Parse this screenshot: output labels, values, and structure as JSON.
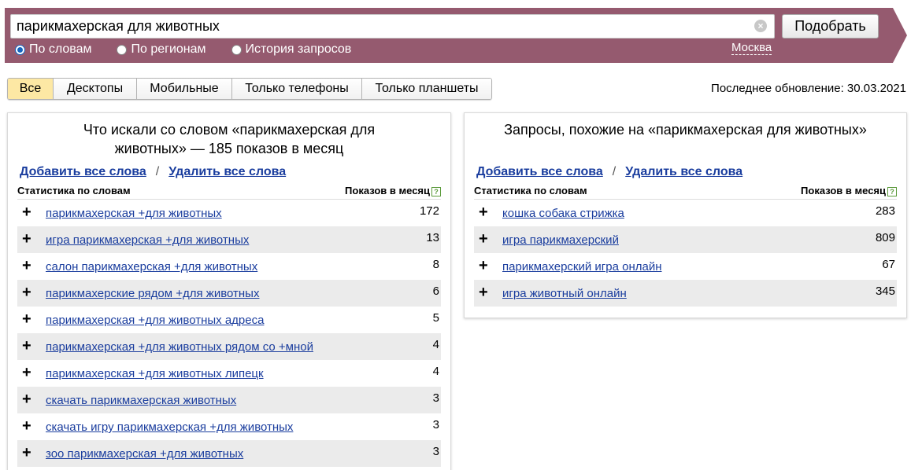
{
  "search": {
    "query": "парикмахерская для животных",
    "button_label": "Подобрать",
    "clear_icon": "x-circle-icon",
    "modes": [
      {
        "label": "По словам",
        "checked": true
      },
      {
        "label": "По регионам",
        "checked": false
      },
      {
        "label": "История запросов",
        "checked": false
      }
    ],
    "region": "Москва"
  },
  "colors": {
    "header_band": "#955a6f",
    "active_tab": "#fde8a4",
    "link": "#1a3d9e"
  },
  "tabs": [
    {
      "label": "Все",
      "active": true
    },
    {
      "label": "Десктопы",
      "active": false
    },
    {
      "label": "Мобильные",
      "active": false
    },
    {
      "label": "Только телефоны",
      "active": false
    },
    {
      "label": "Только планшеты",
      "active": false
    }
  ],
  "last_update": "Последнее обновление: 30.03.2021",
  "left_panel": {
    "title": "Что искали со словом «парикмахерская для животных» — 185 показов в месяц",
    "add_all": "Добавить все слова",
    "separator": "/",
    "remove_all": "Удалить все слова",
    "col_phrase": "Статистика по словам",
    "col_count": "Показов в месяц",
    "rows": [
      {
        "phrase": "парикмахерская +для животных",
        "count": "172"
      },
      {
        "phrase": "игра парикмахерская +для животных",
        "count": "13"
      },
      {
        "phrase": "салон парикмахерская +для животных",
        "count": "8"
      },
      {
        "phrase": "парикмахерские рядом +для животных",
        "count": "6"
      },
      {
        "phrase": "парикмахерская +для животных адреса",
        "count": "5"
      },
      {
        "phrase": "парикмахерская +для животных рядом со +мной",
        "count": "4"
      },
      {
        "phrase": "парикмахерская +для животных липецк",
        "count": "4"
      },
      {
        "phrase": "скачать парикмахерская животных",
        "count": "3"
      },
      {
        "phrase": "скачать игру парикмахерская +для животных",
        "count": "3"
      },
      {
        "phrase": "зоо парикмахерская +для животных",
        "count": "3"
      }
    ]
  },
  "right_panel": {
    "title": "Запросы, похожие на «парикмахерская для животных»",
    "add_all": "Добавить все слова",
    "separator": "/",
    "remove_all": "Удалить все слова",
    "col_phrase": "Статистика по словам",
    "col_count": "Показов в месяц",
    "rows": [
      {
        "phrase": "кошка собака стрижка",
        "count": "283"
      },
      {
        "phrase": "игра парикмахерский",
        "count": "809"
      },
      {
        "phrase": "парикмахерский игра онлайн",
        "count": "67"
      },
      {
        "phrase": "игра животный онлайн",
        "count": "345"
      }
    ]
  }
}
